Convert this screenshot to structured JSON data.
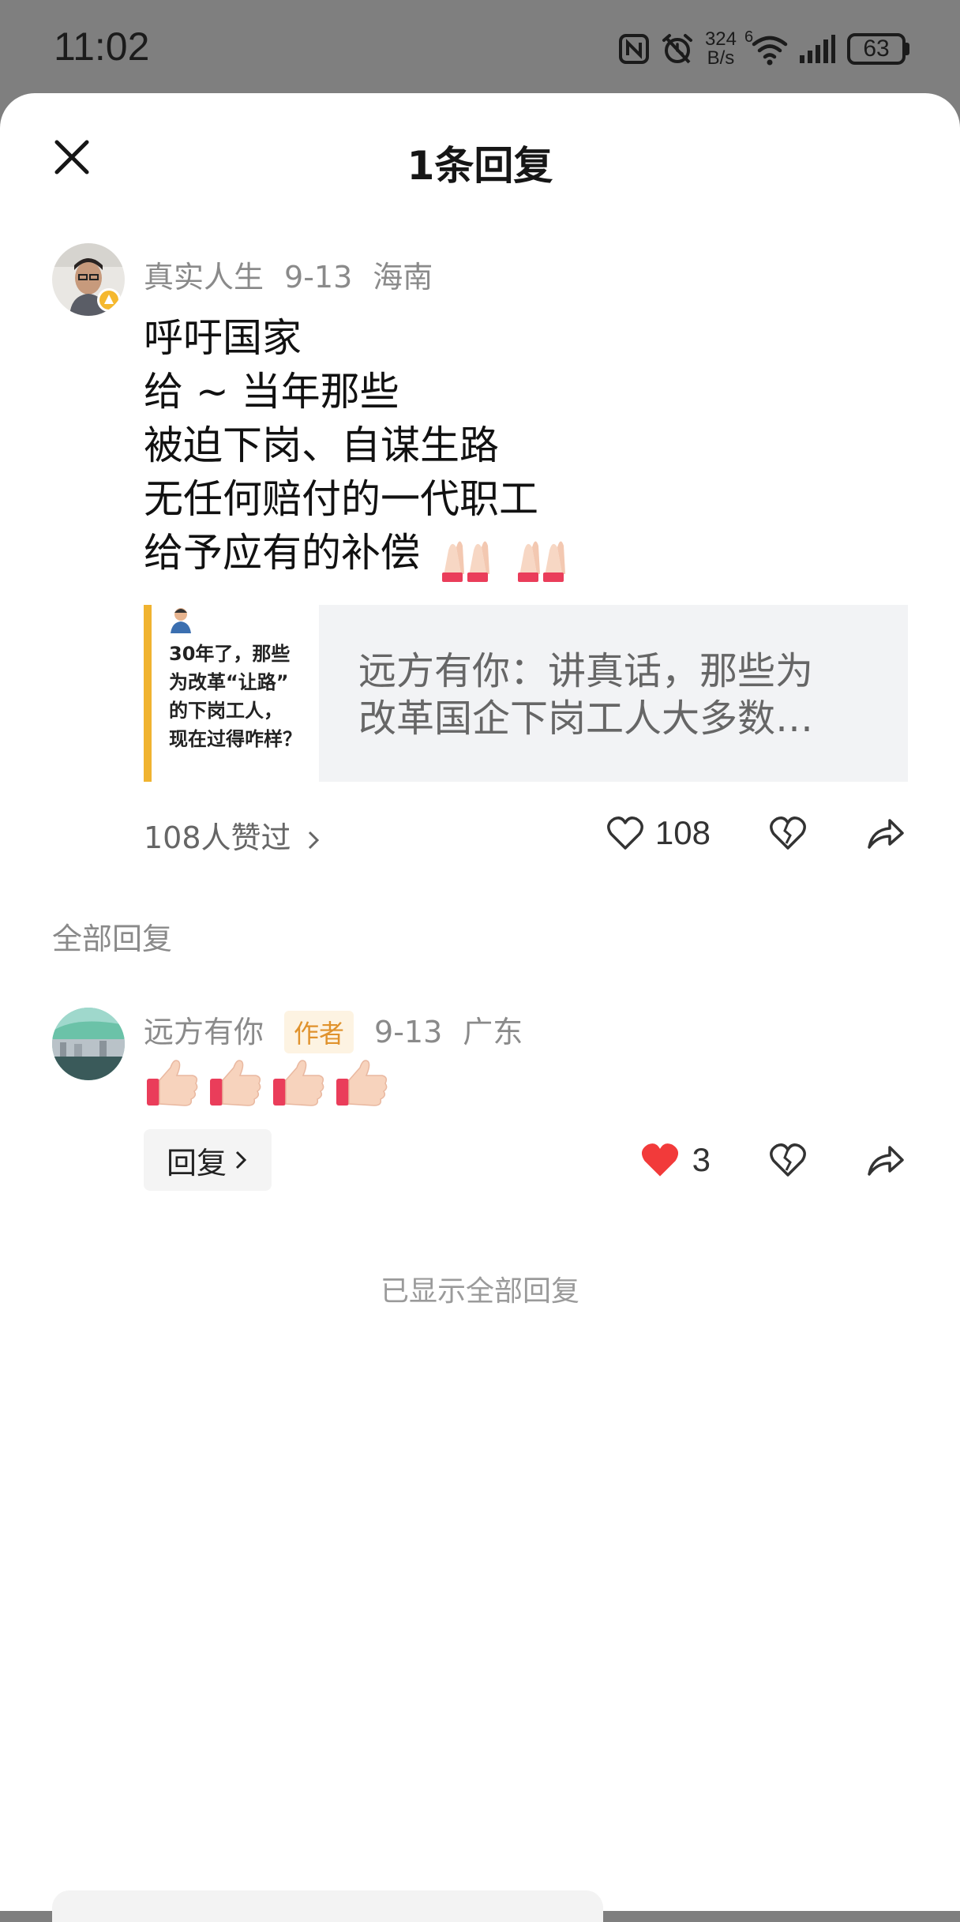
{
  "status_bar": {
    "time": "11:02",
    "net_speed_value": "324",
    "net_speed_unit": "B/s",
    "wifi_sup": "6",
    "battery": "63",
    "icons": [
      "nfc-icon",
      "alarm-off-icon",
      "wifi-icon",
      "signal-icon",
      "battery-icon"
    ]
  },
  "sheet": {
    "title": "1条回复",
    "close_icon": "close-icon"
  },
  "main_comment": {
    "username": "真实人生",
    "date": "9-13",
    "location": "海南",
    "lines": [
      "呼吁国家",
      "给 ~ 当年那些",
      "被迫下岗、自谋生路",
      "无任何赔付的一代职工",
      "给予应有的补偿"
    ],
    "emoji": "folded-hands",
    "link_card": {
      "thumb_lines": [
        "30年了，那些",
        "为改革“让路”",
        "的下岗工人，",
        "现在过得咋样？"
      ],
      "text_lines": [
        "远方有你：讲真话，那些为",
        "改革国企下岗工人大多数…"
      ]
    },
    "likes_summary": "108人赞过",
    "like_count": "108"
  },
  "section_label": "全部回复",
  "reply": {
    "username": "远方有你",
    "badge": "作者",
    "date": "9-13",
    "location": "广东",
    "emoji": "thumbs-up",
    "reply_button": "回复",
    "like_count": "3",
    "like_color": "#f23a3a"
  },
  "end_label": "已显示全部回复"
}
